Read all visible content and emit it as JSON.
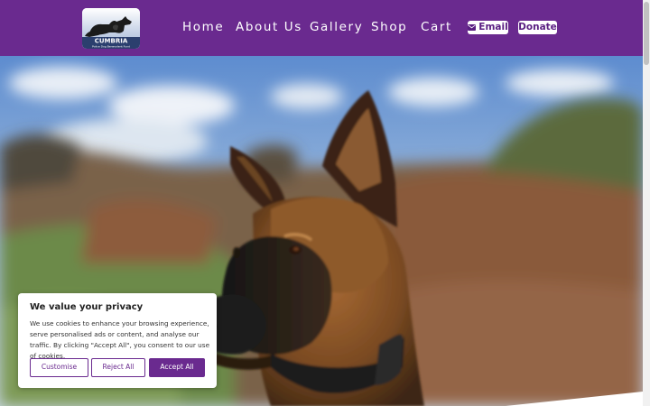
{
  "header": {
    "logo": {
      "text": "CUMBRIA",
      "subtext": "Police Dog Benevolent Fund"
    },
    "nav": [
      {
        "label": "Home"
      },
      {
        "label": "About Us"
      },
      {
        "label": "Gallery"
      },
      {
        "label": "Shop"
      },
      {
        "label": "Cart"
      }
    ],
    "email_label": "Email",
    "donate_label": "Donate",
    "colors": {
      "brand_purple": "#6a2a8f",
      "button_text": "#5a1f82"
    }
  },
  "hero": {
    "subject": "police dog in field"
  },
  "cookie_banner": {
    "title": "We value your privacy",
    "text": "We use cookies to enhance your browsing experience, serve personalised ads or content, and analyse our traffic. By clicking \"Accept All\", you consent to our use of cookies.",
    "buttons": {
      "customise": "Customise",
      "reject": "Reject All",
      "accept": "Accept All"
    }
  },
  "icons": {
    "email": "envelope-icon"
  }
}
